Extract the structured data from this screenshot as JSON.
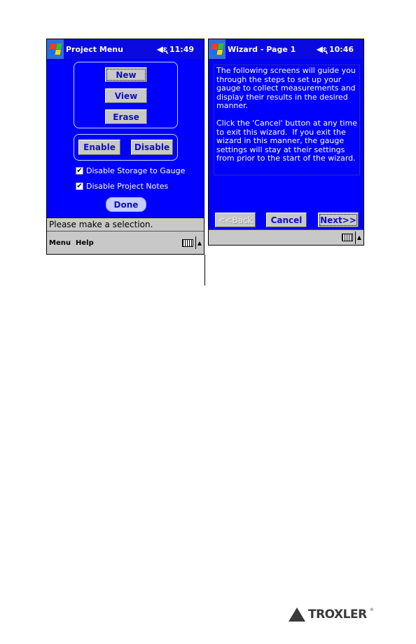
{
  "left_screen": {
    "title": "Project Menu",
    "time": "11:49",
    "speaker_icon": "speaker-icon",
    "start_icon": "windows-flag-icon",
    "buttons": {
      "new": "New",
      "view": "View",
      "erase": "Erase",
      "enable": "Enable",
      "disable": "Disable",
      "done": "Done"
    },
    "checkboxes": [
      {
        "label": "Disable Storage to Gauge",
        "checked": true
      },
      {
        "label": "Disable Project Notes",
        "checked": true
      }
    ],
    "status": "Please make a selection.",
    "menu": [
      "Menu",
      "Help"
    ]
  },
  "right_screen": {
    "title": "Wizard - Page 1",
    "time": "10:46",
    "body": "The following screens will guide you through the steps to set up your gauge to collect measurements and display their results in the desired manner.\n\nClick the 'Cancel' button at any time to exit this wizard.  If you exit the wizard in this manner, the gauge settings will stay at their settings from prior to the start of the wizard.",
    "buttons": {
      "back": "<<Back",
      "cancel": "Cancel",
      "next": "Next>>"
    }
  },
  "check_mark": "✔",
  "logo": {
    "text": "TROXLER",
    "reg": "®"
  },
  "colors": {
    "screen_blue": "#0000ff",
    "button_text": "#1010c0",
    "bar_gray": "#c8c8c8"
  }
}
